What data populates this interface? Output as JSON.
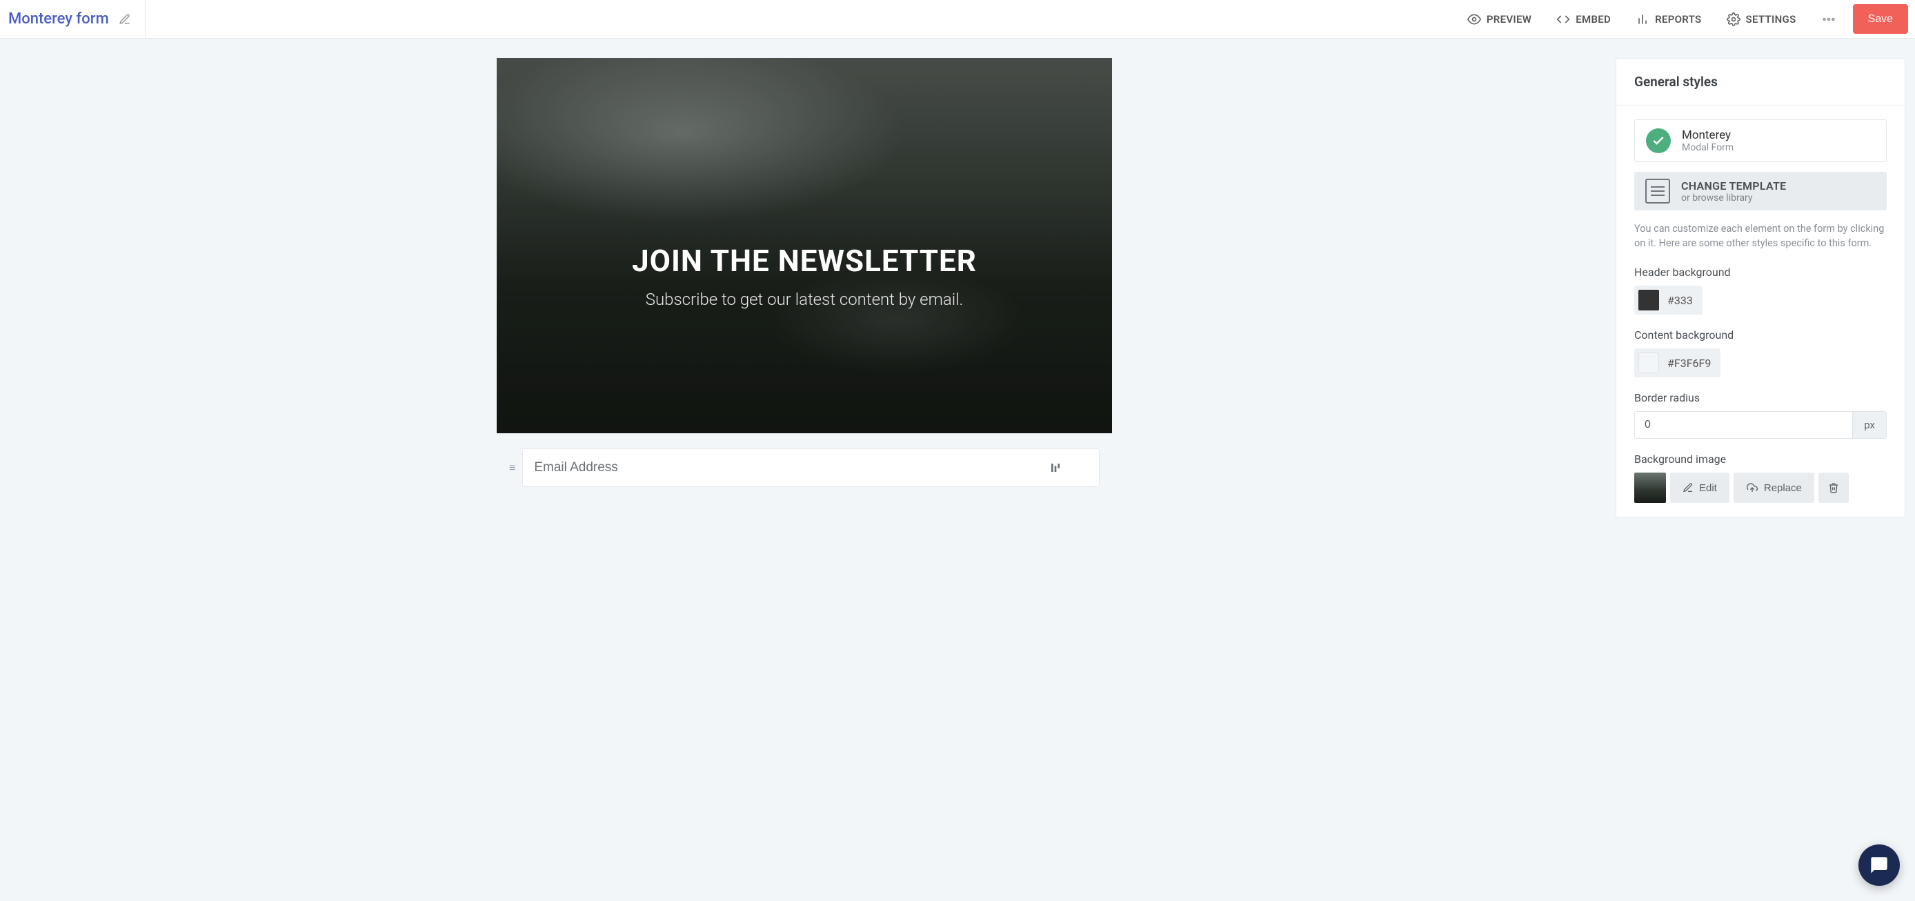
{
  "header": {
    "title": "Monterey form",
    "nav": {
      "preview": "PREVIEW",
      "embed": "EMBED",
      "reports": "REPORTS",
      "settings": "SETTINGS"
    },
    "save": "Save"
  },
  "canvas": {
    "heading": "JOIN THE NEWSLETTER",
    "subheading": "Subscribe to get our latest content by email.",
    "email_placeholder": "Email Address"
  },
  "sidebar": {
    "title": "General styles",
    "template": {
      "name": "Monterey",
      "type": "Modal Form"
    },
    "change": {
      "title": "CHANGE TEMPLATE",
      "sub": "or browse library"
    },
    "help": "You can customize each element on the form by clicking on it. Here are some other styles specific to this form.",
    "header_bg": {
      "label": "Header background",
      "value": "#333",
      "swatch": "#333333"
    },
    "content_bg": {
      "label": "Content background",
      "value": "#F3F6F9",
      "swatch": "#F3F6F9"
    },
    "radius": {
      "label": "Border radius",
      "value": "0",
      "unit": "px"
    },
    "bg_image": {
      "label": "Background image",
      "edit": "Edit",
      "replace": "Replace"
    }
  }
}
